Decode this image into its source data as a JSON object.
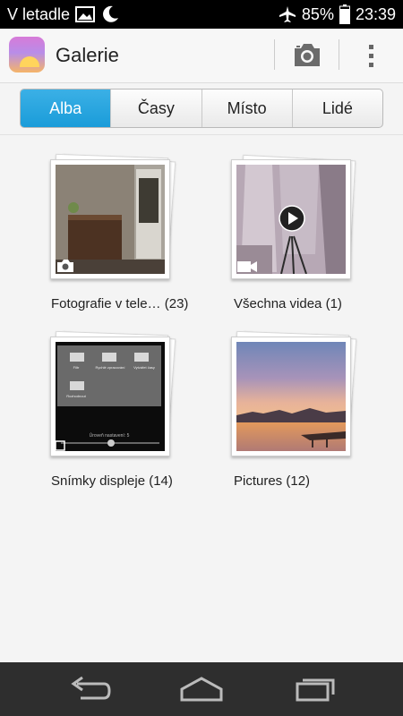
{
  "status_bar": {
    "carrier_text": "V letadle",
    "battery": "85%",
    "time": "23:39",
    "icons": [
      "image-icon",
      "moon-icon",
      "airplane-icon",
      "battery-icon"
    ]
  },
  "app_bar": {
    "title": "Galerie",
    "actions": [
      "camera-icon",
      "overflow-menu-icon"
    ]
  },
  "tabs": [
    {
      "label": "Alba",
      "active": true
    },
    {
      "label": "Časy",
      "active": false
    },
    {
      "label": "Místo",
      "active": false
    },
    {
      "label": "Lidé",
      "active": false
    }
  ],
  "albums": [
    {
      "name": "Fotografie v tele…",
      "count": "(23)",
      "type_icon": "camera-icon"
    },
    {
      "name": "Všechna videa",
      "count": "(1)",
      "type_icon": "video-camera-icon"
    },
    {
      "name": "Snímky displeje",
      "count": "(14)",
      "type_icon": "screenshot-icon"
    },
    {
      "name": "Pictures",
      "count": "(12)",
      "type_icon": ""
    }
  ],
  "screenshot_thumb": {
    "tiles": [
      "Filtr",
      "Rychlé zpracování",
      "Vytvářet časy",
      "Rozhodnout"
    ],
    "slider_text": "Úroveň nastavení: 5"
  },
  "nav_bar": [
    "back-icon",
    "home-icon",
    "recents-icon"
  ],
  "colors": {
    "accent": "#1a9cd9",
    "nav_bg": "#2e2e2e",
    "status_bg": "#000000"
  }
}
